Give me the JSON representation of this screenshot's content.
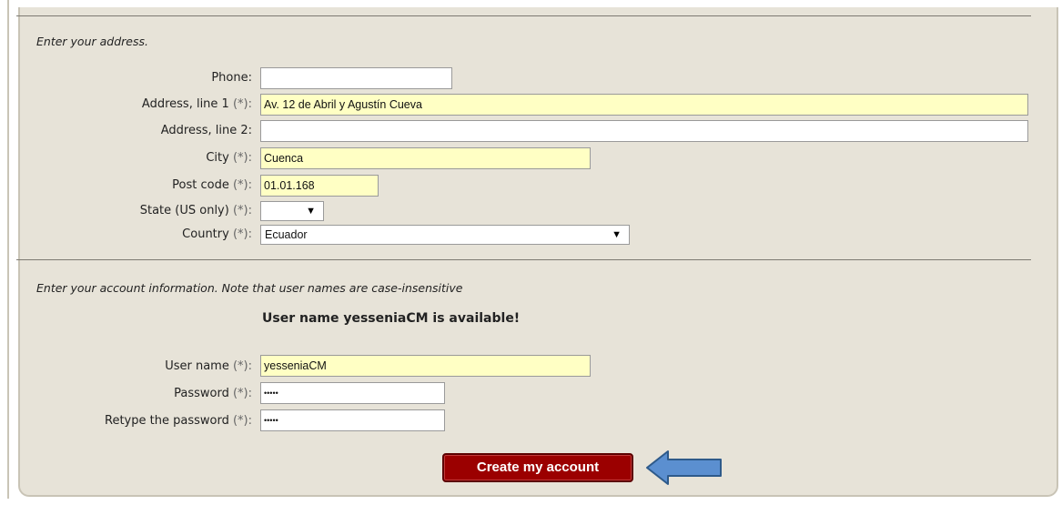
{
  "address_section": {
    "instructions": "Enter your address.",
    "fields": [
      {
        "label": "Phone:",
        "required": false,
        "value": ""
      },
      {
        "label": "Address, line 1",
        "required": true,
        "value": "Av. 12 de Abril y Agustín Cueva"
      },
      {
        "label": "Address, line 2:",
        "required": false,
        "value": ""
      },
      {
        "label": "City",
        "required": true,
        "value": "Cuenca"
      },
      {
        "label": "Post code",
        "required": true,
        "value": "01.01.168"
      },
      {
        "label": "State (US only)",
        "required": true,
        "value": ""
      },
      {
        "label": "Country",
        "required": true,
        "value": "Ecuador"
      }
    ]
  },
  "required_marker": "(*):",
  "account_section": {
    "instructions": "Enter your account information. Note that user names are case-insensitive",
    "availability_message": "User name yesseniaCM is available!",
    "fields": [
      {
        "label": "User name",
        "required": true,
        "value": "yesseniaCM"
      },
      {
        "label": "Password",
        "required": true,
        "value": "•••••"
      },
      {
        "label": "Retype the password",
        "required": true,
        "value": "•••••"
      }
    ]
  },
  "submit_label": "Create my account",
  "colors": {
    "panel_bg": "#e7e3d8",
    "required_field_bg": "#ffffc4",
    "button_bg": "#9b0000",
    "arrow_fill": "#5b8fd0",
    "arrow_stroke": "#2e5a8a"
  },
  "icons": {
    "select_arrow": "▼",
    "pointer": "left-arrow-icon"
  }
}
